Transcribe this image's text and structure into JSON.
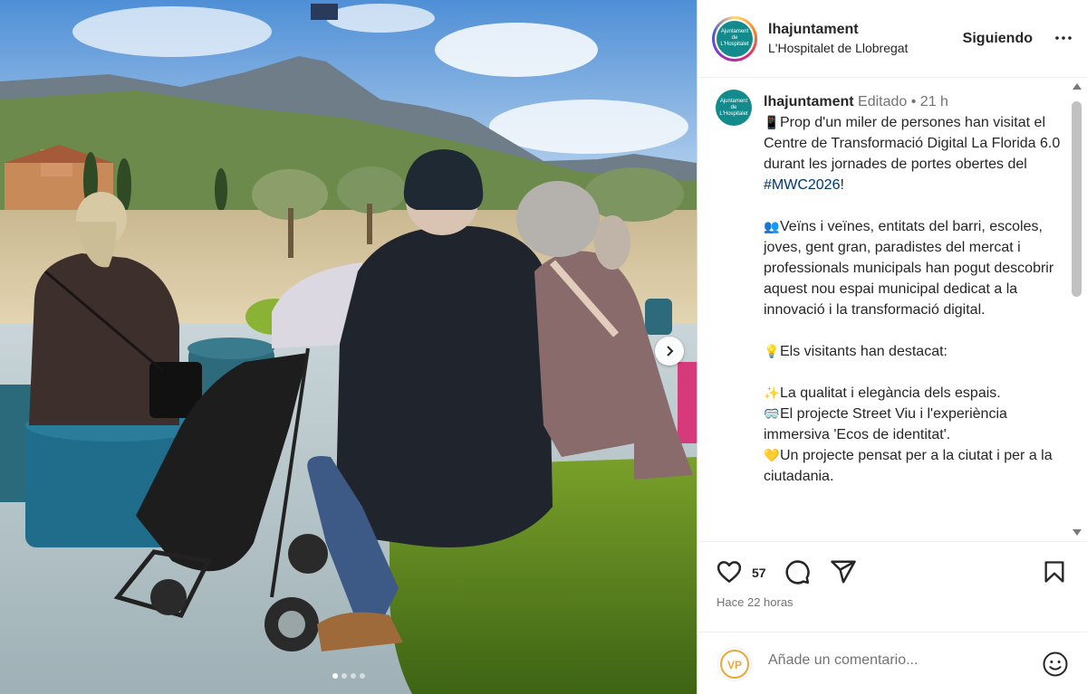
{
  "post": {
    "username": "lhajuntament",
    "location": "L'Hospitalet de Llobregat",
    "follow_label": "Siguiendo",
    "avatar_text": "Ajuntament de L'Hospitalet",
    "slide_count": 4,
    "active_slide": 1
  },
  "caption": {
    "username": "lhajuntament",
    "edited": "Editado",
    "separator": "•",
    "time": "21 h",
    "p1_emoji": "📱",
    "p1_text": "Prop d'un miler de persones han visitat el Centre de Transformació Digital La Florida 6.0 durant les jornades de portes obertes del ",
    "p1_hashtag": "#MWC2026",
    "p1_end": "!",
    "p2_emoji": "👥",
    "p2_text": "Veïns i veïnes, entitats del barri, escoles, joves, gent gran, paradistes del mercat i professionals municipals han pogut descobrir aquest nou espai municipal dedicat a la innovació i la transformació digital.",
    "p3_emoji": "💡",
    "p3_text": "Els visitants han destacat:",
    "b1_emoji": "✨",
    "b1_text": "La qualitat i elegància dels espais.",
    "b2_emoji": "🥽",
    "b2_text": "El projecte Street Viu i l'experiència immersiva 'Ecos de identitat'.",
    "b3_emoji": "💛",
    "b3_text": "Un projecte pensat per a la ciutat i per a la ciutadania."
  },
  "actions": {
    "likes": "57",
    "time_ago": "Hace 22 horas"
  },
  "comment": {
    "placeholder": "Añade un comentario...",
    "avatar_text": "VP"
  },
  "colors": {
    "brand_teal": "#138a8c",
    "hashtag": "#00376b",
    "muted": "#737373"
  }
}
